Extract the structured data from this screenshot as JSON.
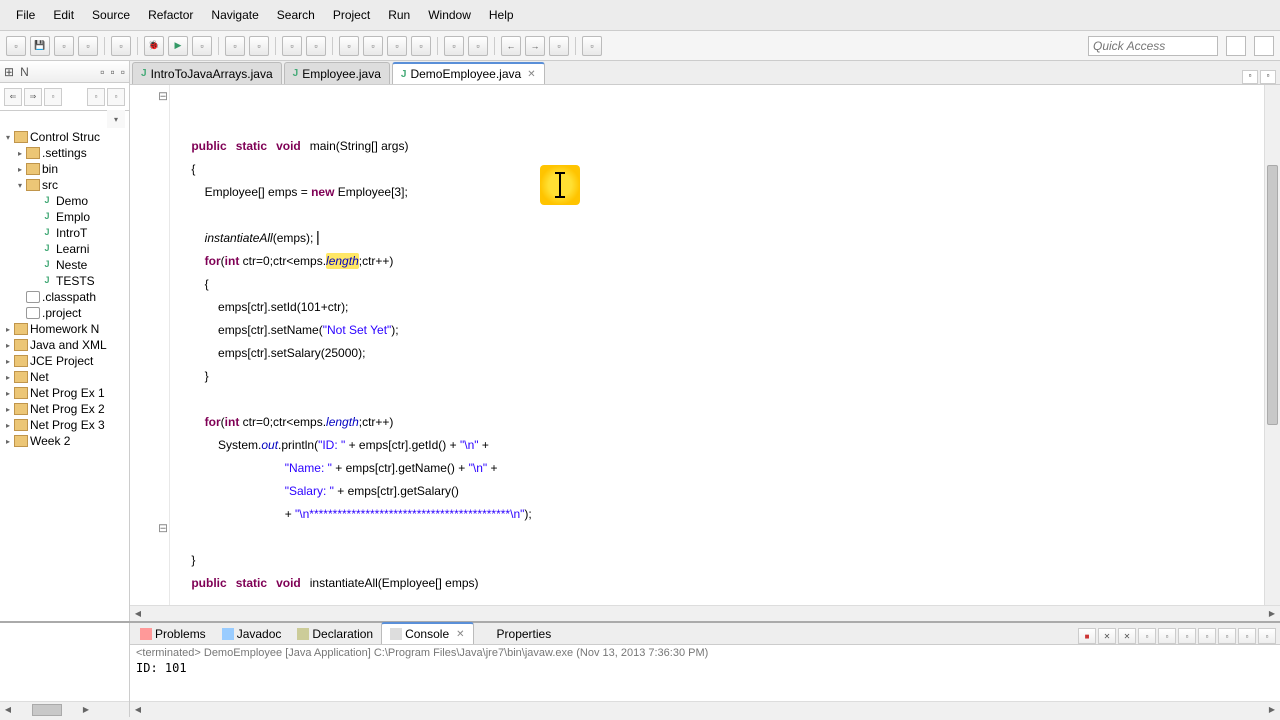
{
  "menu": {
    "items": [
      "File",
      "Edit",
      "Source",
      "Refactor",
      "Navigate",
      "Search",
      "Project",
      "Run",
      "Window",
      "Help"
    ]
  },
  "quick_access": "Quick Access",
  "sidebar": {
    "header_items": [
      "N",
      "▾"
    ],
    "tree": {
      "root": "Control Struc",
      "settings": ".settings",
      "bin": "bin",
      "src": "src",
      "files": [
        "Demo",
        "Emplo",
        "IntroT",
        "Learni",
        "Neste",
        "TESTS"
      ],
      "classpath": ".classpath",
      "project_file": ".project",
      "projects": [
        "Homework N",
        "Java and XML",
        "JCE Project",
        "Net",
        "Net Prog Ex 1",
        "Net Prog Ex 2",
        "Net Prog Ex 3",
        "Week 2"
      ]
    }
  },
  "editor": {
    "tabs": [
      {
        "label": "IntroToJavaArrays.java",
        "active": false
      },
      {
        "label": "Employee.java",
        "active": false
      },
      {
        "label": "DemoEmployee.java",
        "active": true
      }
    ]
  },
  "code": {
    "l1a": "public",
    "l1b": "static",
    "l1c": "void",
    "l1d": "main(String[] args)",
    "l2": "{",
    "l3a": "Employee[] emps = ",
    "l3b": "new",
    "l3c": " Employee[3];",
    "l4": "",
    "l5a": "instantiateAll",
    "l5b": "(emps);",
    "l6a": "for",
    "l6b": "(",
    "l6c": "int",
    "l6d": " ctr=0;ctr<emps.",
    "l6e": "length",
    "l6f": ";ctr++)",
    "l7": "{",
    "l8a": "emps[ctr].setId(101+ctr);",
    "l9a": "emps[ctr].setName(",
    "l9b": "\"Not Set Yet\"",
    "l9c": ");",
    "l10a": "emps[ctr].setSalary(25000);",
    "l11": "}",
    "l12": "",
    "l13a": "for",
    "l13b": "(",
    "l13c": "int",
    "l13d": " ctr=0;ctr<emps.",
    "l13e": "length",
    "l13f": ";ctr++)",
    "l14a": "System.",
    "l14b": "out",
    "l14c": ".println(",
    "l14d": "\"ID: \"",
    "l14e": " + emps[ctr].getId() + ",
    "l14f": "\"\\n\"",
    "l14g": " +",
    "l15a": "\"Name: \"",
    "l15b": " + emps[ctr].getName() + ",
    "l15c": "\"\\n\"",
    "l15d": " +",
    "l16a": "\"Salary: \"",
    "l16b": " + emps[ctr].getSalary()",
    "l17a": "+ ",
    "l17b": "\"\\n*******************************************\\n\"",
    "l17c": ");",
    "l18": "",
    "l19": "}",
    "l20a": "public",
    "l20b": "static",
    "l20c": "void",
    "l20d": "instantiateAll(Employee[] emps)"
  },
  "console": {
    "tabs": [
      "Problems",
      "Javadoc",
      "Declaration",
      "Console",
      "Properties"
    ],
    "active_tab": "Console",
    "status": "<terminated> DemoEmployee [Java Application] C:\\Program Files\\Java\\jre7\\bin\\javaw.exe (Nov 13, 2013 7:36:30 PM)",
    "output": "ID: 101"
  }
}
